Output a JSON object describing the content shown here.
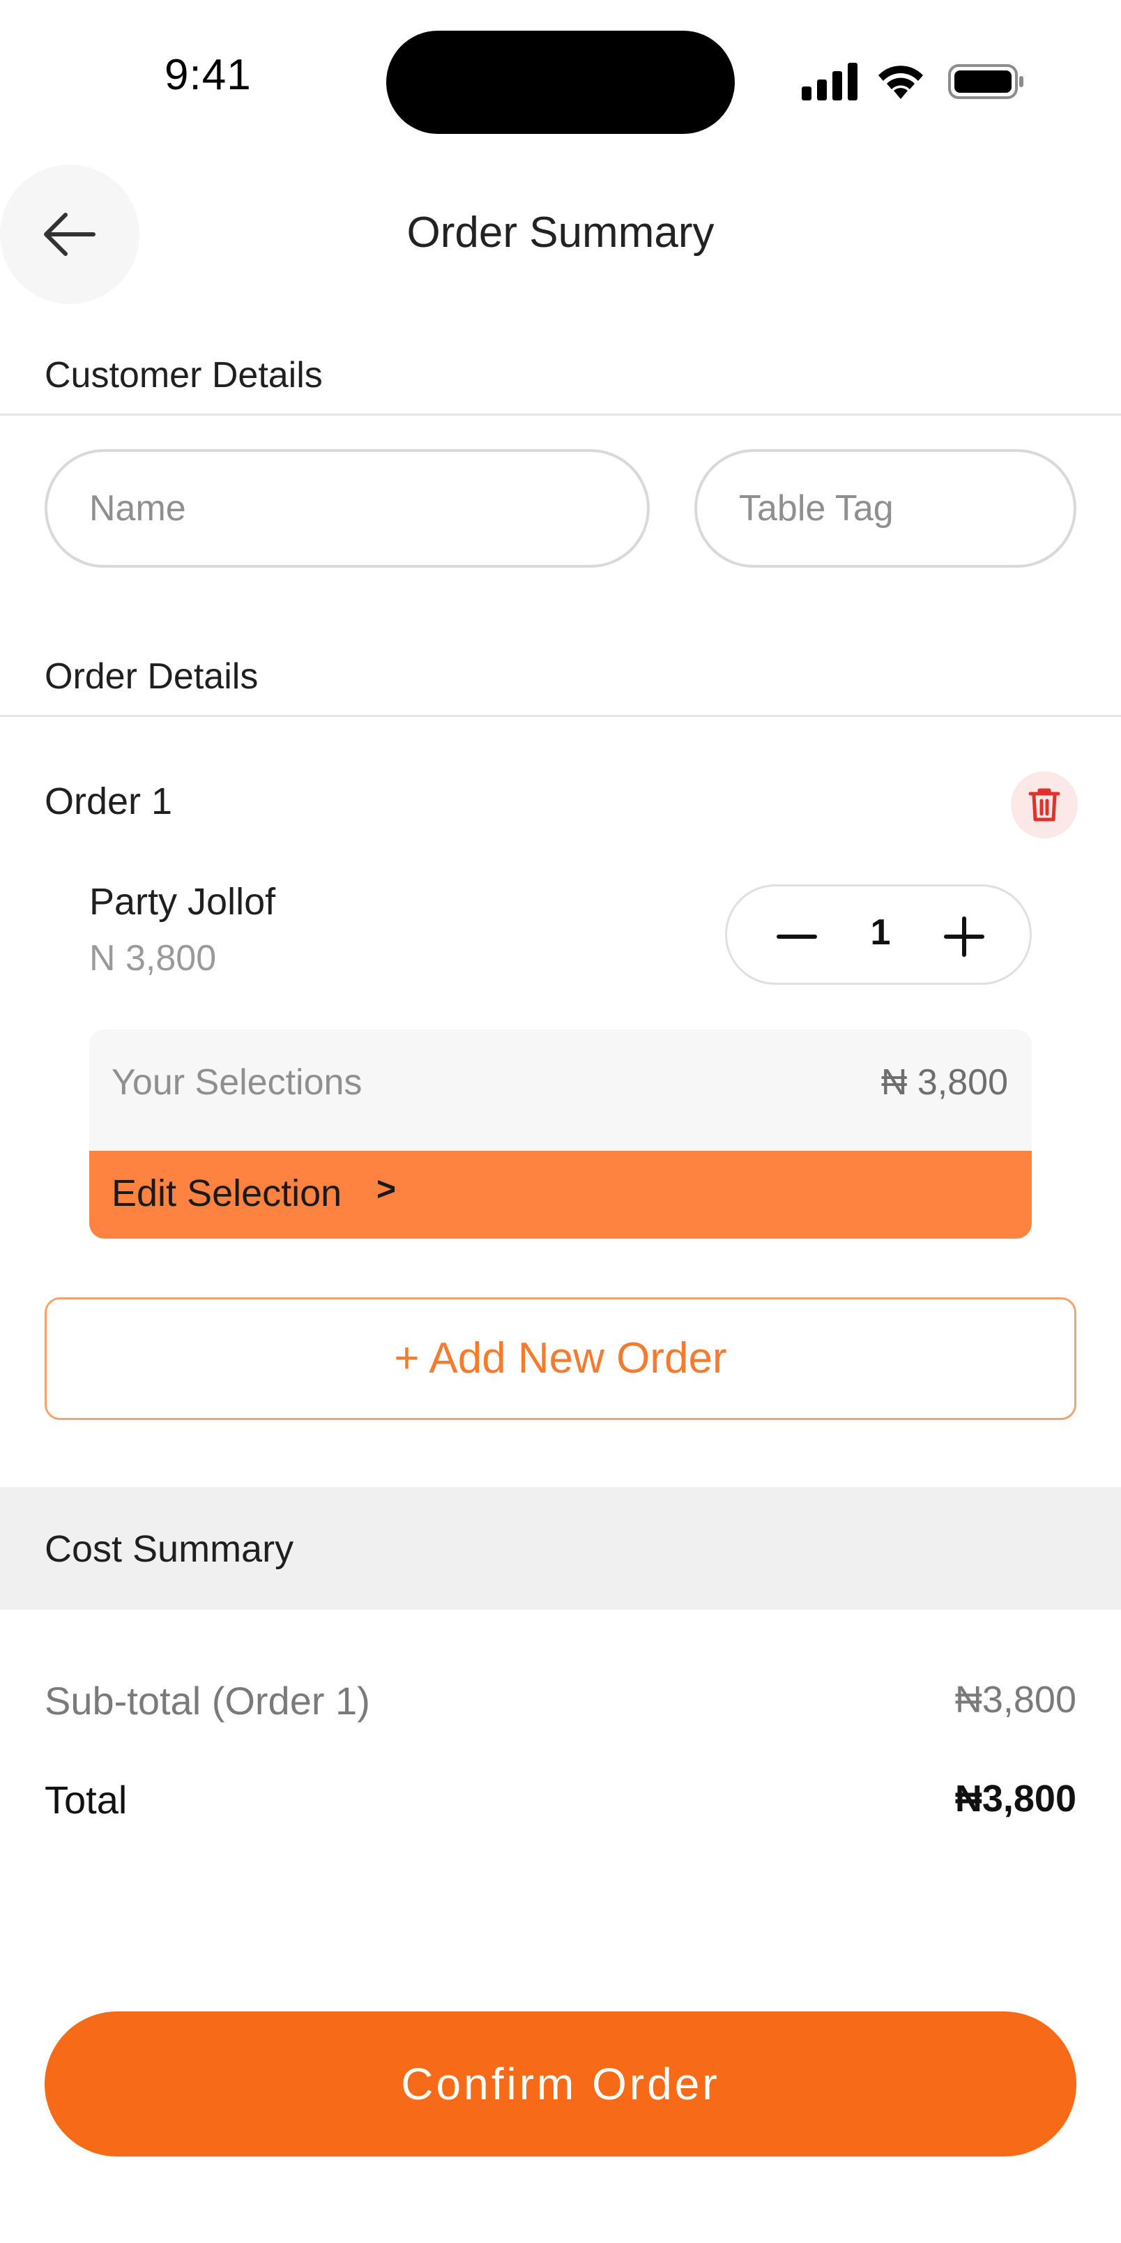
{
  "status_bar": {
    "time": "9:41"
  },
  "header": {
    "title": "Order Summary"
  },
  "customer": {
    "section_title": "Customer Details",
    "name_placeholder": "Name",
    "name_value": "",
    "table_placeholder": "Table Tag",
    "table_value": ""
  },
  "order_details": {
    "section_title": "Order Details",
    "orders": [
      {
        "label": "Order 1",
        "item": {
          "name": "Party Jollof",
          "price": "N 3,800",
          "quantity": "1"
        },
        "selections": {
          "label": "Your Selections",
          "price": "₦ 3,800",
          "edit_label": "Edit Selection",
          "edit_chevron": ">"
        }
      }
    ],
    "add_order_label": "+ Add New Order"
  },
  "cost_summary": {
    "title": "Cost Summary",
    "subtotal_label": "Sub-total (Order 1)",
    "subtotal_value": "₦3,800",
    "total_label": "Total",
    "total_value": "₦3,800"
  },
  "confirm_label": "Confirm Order",
  "icons": {
    "back": "arrow-left-icon",
    "delete": "trash-icon",
    "minus": "minus-icon",
    "plus": "plus-icon",
    "signal": "cellular-signal-icon",
    "wifi": "wifi-icon",
    "battery": "battery-icon"
  },
  "colors": {
    "accent": "#f76b18",
    "edit_bar": "#ff8340",
    "add_order_text": "#f57c2e",
    "delete_icon": "#e0322a",
    "delete_bg": "#fde8e8"
  }
}
